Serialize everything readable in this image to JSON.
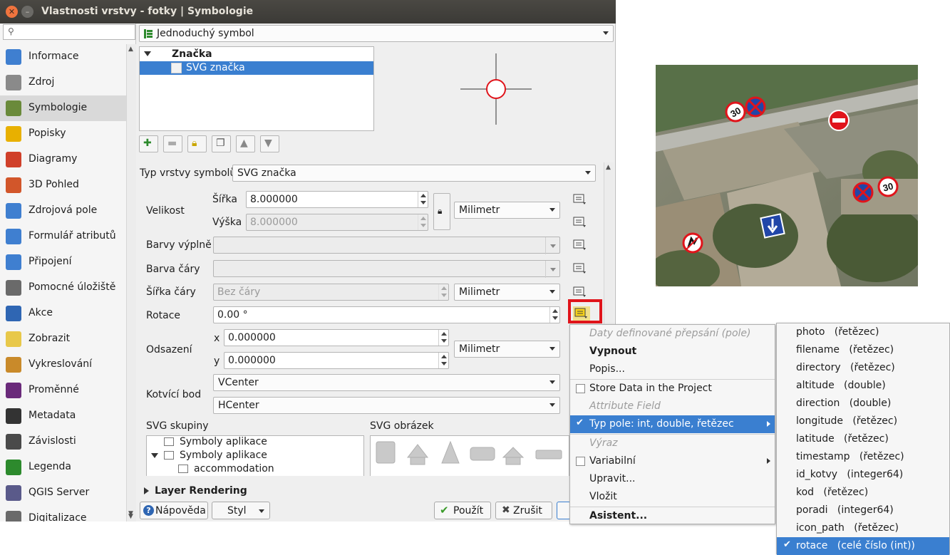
{
  "window": {
    "title": "Vlastnosti vrstvy - fotky | Symbologie"
  },
  "search": {
    "placeholder": ""
  },
  "sidebar": {
    "items": [
      {
        "label": "Informace",
        "icon": "info-icon"
      },
      {
        "label": "Zdroj",
        "icon": "wrench-icon"
      },
      {
        "label": "Symbologie",
        "icon": "brush-icon"
      },
      {
        "label": "Popisky",
        "icon": "abc-label-icon"
      },
      {
        "label": "Diagramy",
        "icon": "diagram-icon"
      },
      {
        "label": "3D Pohled",
        "icon": "cube-icon"
      },
      {
        "label": "Zdrojová pole",
        "icon": "fields-icon"
      },
      {
        "label": "Formulář atributů",
        "icon": "form-icon"
      },
      {
        "label": "Připojení",
        "icon": "join-icon"
      },
      {
        "label": "Pomocné úložiště",
        "icon": "storage-icon"
      },
      {
        "label": "Akce",
        "icon": "gear-icon"
      },
      {
        "label": "Zobrazit",
        "icon": "speech-bubble-icon"
      },
      {
        "label": "Vykreslování",
        "icon": "paintbrush-icon"
      },
      {
        "label": "Proměnné",
        "icon": "epsilon-icon"
      },
      {
        "label": "Metadata",
        "icon": "metadata-icon"
      },
      {
        "label": "Závislosti",
        "icon": "dependencies-icon"
      },
      {
        "label": "Legenda",
        "icon": "legend-icon"
      },
      {
        "label": "QGIS Server",
        "icon": "server-icon"
      },
      {
        "label": "Digitalizace",
        "icon": "digitize-icon"
      }
    ],
    "selected_index": 2
  },
  "renderer": {
    "value": "Jednoduchý symbol"
  },
  "tree": {
    "root": "Značka",
    "child": "SVG značka"
  },
  "symbol_layer": {
    "label": "Typ vrstvy symbolů",
    "value": "SVG značka"
  },
  "size": {
    "label": "Velikost",
    "width_label": "Šířka",
    "width_value": "8.000000",
    "height_label": "Výška",
    "height_value": "8.000000",
    "unit": "Milimetr"
  },
  "fill_color": {
    "label": "Barvy výplně"
  },
  "stroke_color": {
    "label": "Barva čáry"
  },
  "stroke_width": {
    "label": "Šířka čáry",
    "value": "Bez čáry",
    "unit": "Milimetr"
  },
  "rotation": {
    "label": "Rotace",
    "value": "0.00 °"
  },
  "offset": {
    "label": "Odsazení",
    "x_label": "x",
    "x_value": "0.000000",
    "y_label": "y",
    "y_value": "0.000000",
    "unit": "Milimetr"
  },
  "anchor": {
    "label": "Kotvící bod",
    "v_value": "VCenter",
    "h_value": "HCenter"
  },
  "svg_groups": {
    "label": "SVG skupiny",
    "items": [
      "Symboly aplikace",
      "Symboly aplikace",
      "accommodation"
    ]
  },
  "svg_image": {
    "label": "SVG obrázek"
  },
  "layer_rendering": {
    "label": "Layer Rendering"
  },
  "buttons": {
    "help": "Nápověda",
    "style": "Styl",
    "apply": "Použít",
    "cancel": "Zrušit"
  },
  "context_menu": {
    "title": "Daty definované přepsání (pole)",
    "deactivate": "Vypnout",
    "description": "Popis...",
    "store_data": "Store Data in the Project",
    "attribute_field": "Attribute Field",
    "field_type": "Typ pole: int, double, řetězec",
    "expression": "Výraz",
    "variable": "Variabilní",
    "edit": "Upravit...",
    "paste": "Vložit",
    "assistant": "Asistent..."
  },
  "field_menu": {
    "items": [
      "photo   (řetězec)",
      "filename   (řetězec)",
      "directory   (řetězec)",
      "altitude   (double)",
      "direction   (double)",
      "longitude   (řetězec)",
      "latitude   (řetězec)",
      "timestamp   (řetězec)",
      "id_kotvy   (integer64)",
      "kod   (řetězec)",
      "poradi   (integer64)",
      "icon_path   (řetězec)",
      "rotace   (celé číslo (int))"
    ],
    "checked_index": 12
  },
  "map": {
    "signs": [
      {
        "type": "speed-limit-30-icon",
        "text": "30"
      },
      {
        "type": "no-stopping-icon"
      },
      {
        "type": "no-entry-icon"
      },
      {
        "type": "no-stopping-icon"
      },
      {
        "type": "speed-limit-30-icon",
        "text": "30"
      },
      {
        "type": "one-way-arrow-icon"
      },
      {
        "type": "no-overtaking-icon"
      }
    ]
  },
  "colors": {
    "accent": "#3a7fd0",
    "highlight_frame": "#e0141b"
  }
}
